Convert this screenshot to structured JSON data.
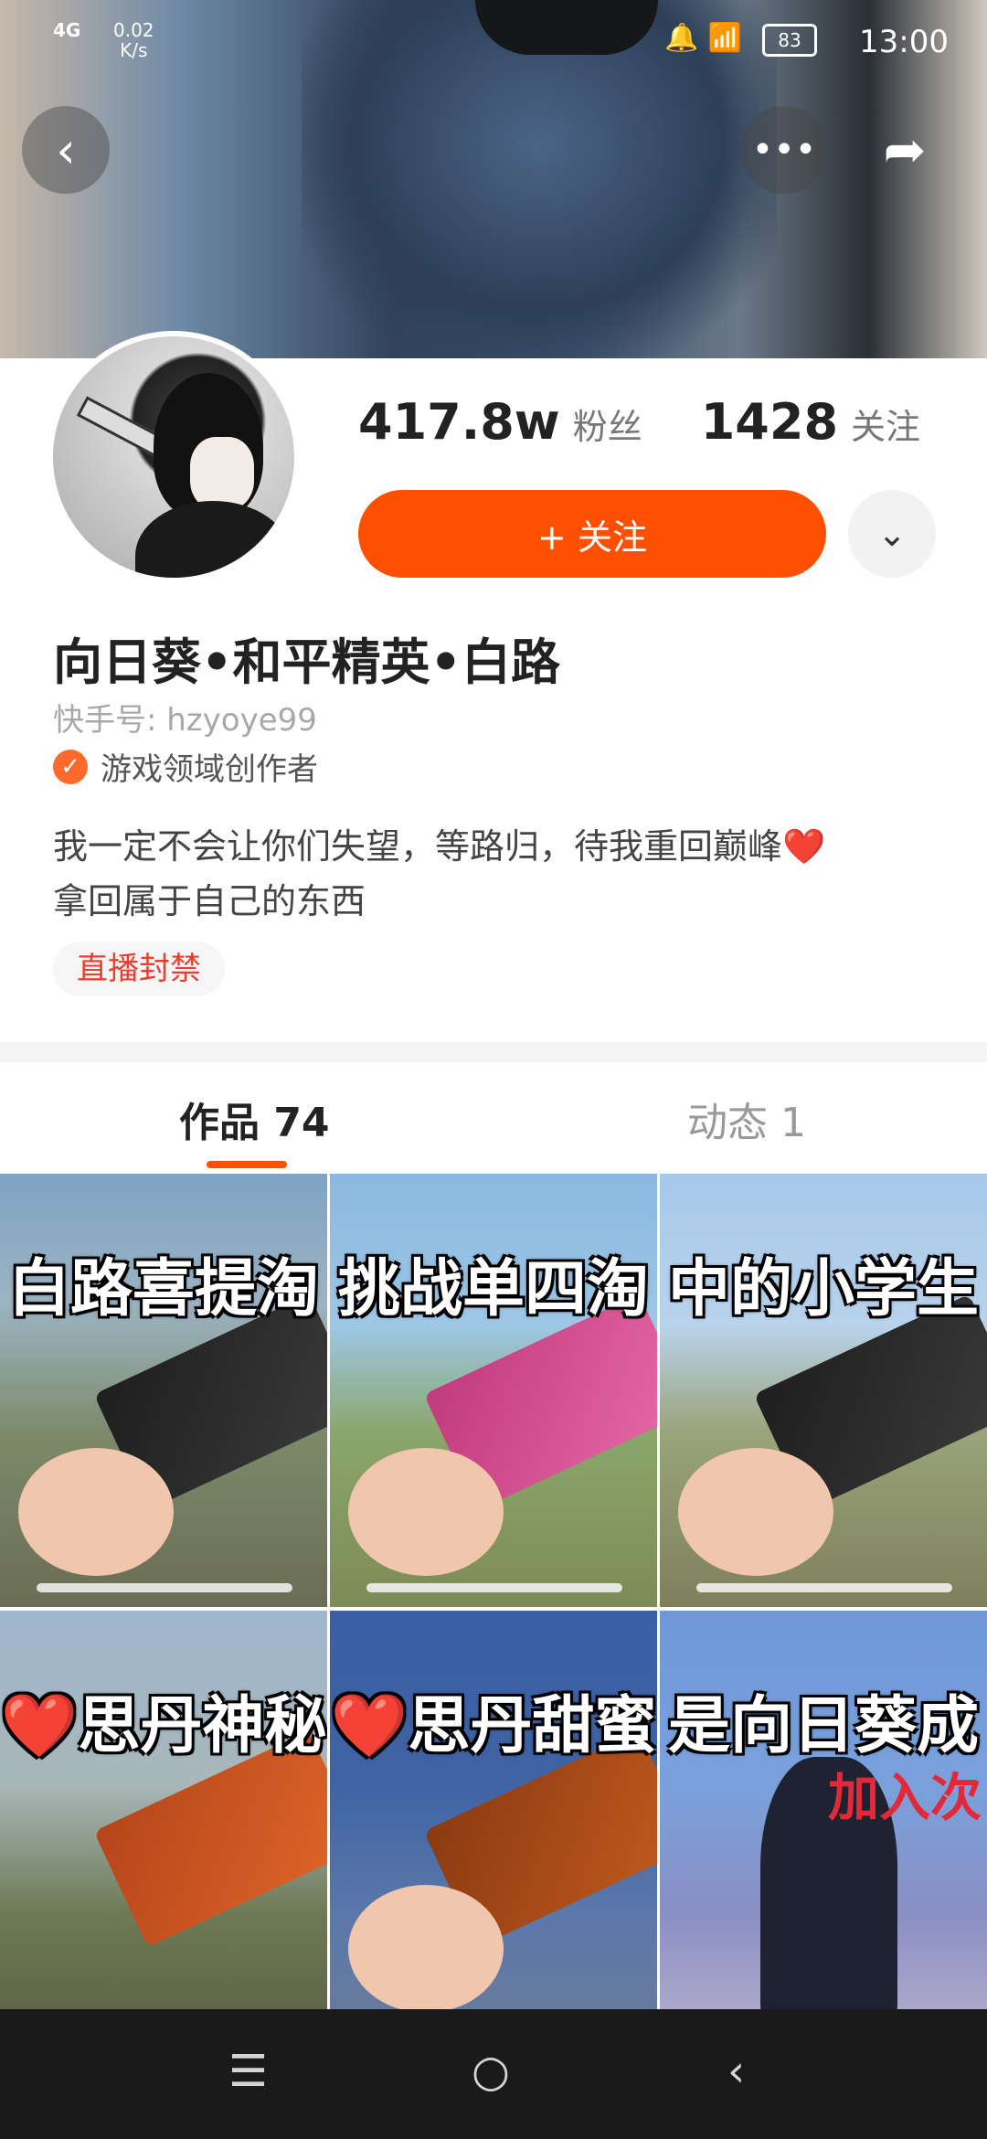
{
  "status_bar": {
    "network": "4G",
    "speed_value": "0.02",
    "speed_unit": "K/s",
    "battery": "83",
    "time": "13:00"
  },
  "header": {
    "back_icon": "chevron-left-icon",
    "more_icon": "more-horizontal-icon",
    "share_icon": "share-arrow-icon"
  },
  "profile": {
    "followers_count": "417.8w",
    "followers_label": "粉丝",
    "following_count": "1428",
    "following_label": "关注",
    "follow_button": "+ 关注",
    "name": "向日葵•和平精英•白路",
    "kuaishou_id": "快手号: hzyoye99",
    "verification": "游戏领域创作者",
    "bio_line1": "我一定不会让你们失望，等路归，待我重回巅峰❤️",
    "bio_line2": "拿回属于自己的东西",
    "tag": "直播封禁"
  },
  "tabs": [
    {
      "label": "作品 74"
    },
    {
      "label": "动态 1"
    }
  ],
  "videos": [
    {
      "caption": "白路喜提淘"
    },
    {
      "caption": "挑战单四淘"
    },
    {
      "caption": "中的小学生"
    },
    {
      "caption": "❤️思丹神秘"
    },
    {
      "caption": "❤️思丹甜蜜"
    },
    {
      "caption": "是向日葵成",
      "subcaption": "加入次"
    }
  ],
  "colors": {
    "accent": "#fe5000",
    "tag_text": "#ee3d2d"
  }
}
